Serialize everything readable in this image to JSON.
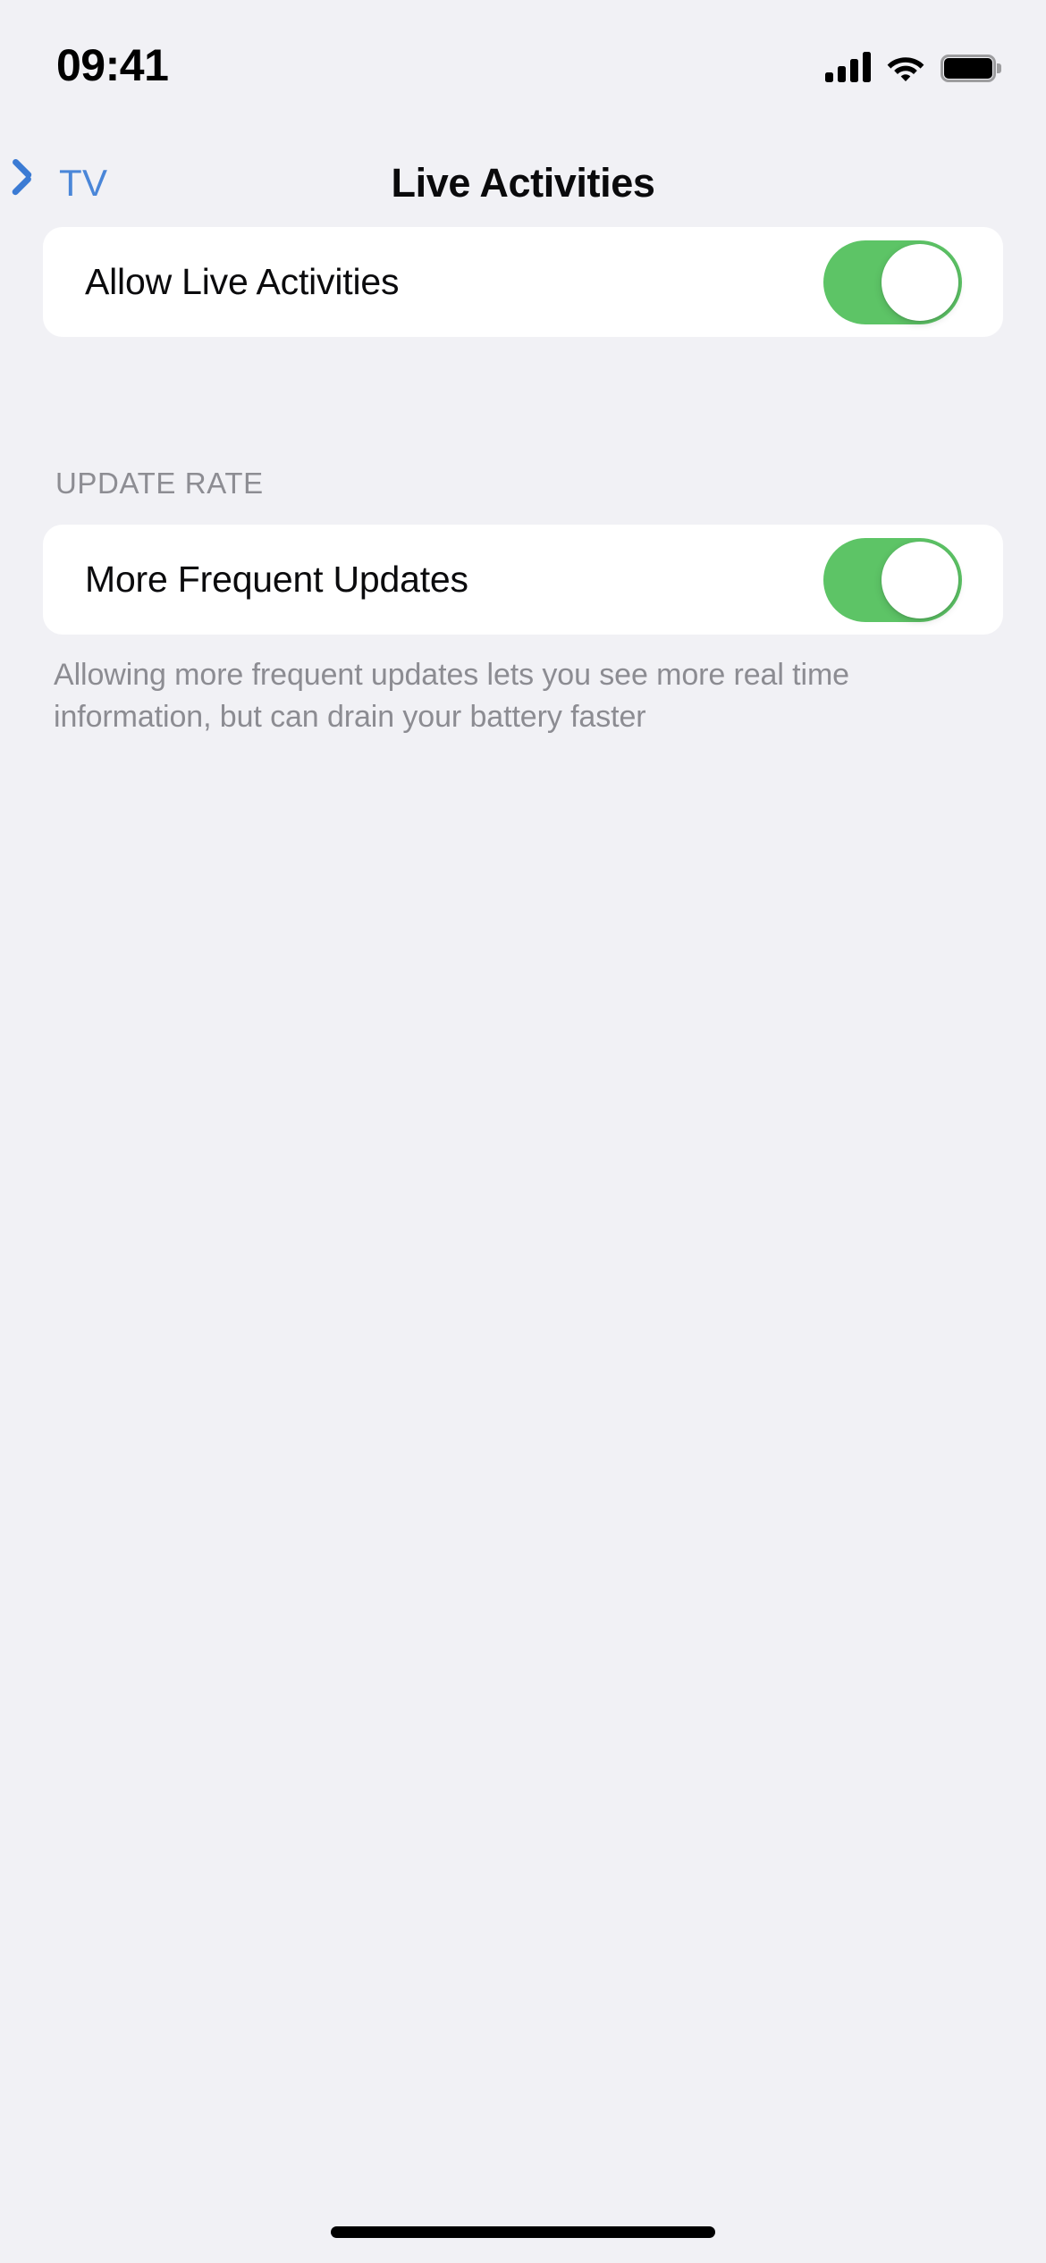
{
  "status_bar": {
    "time": "09:41",
    "signal_icon": "cellular-signal-icon",
    "signal_bars": 4,
    "wifi_icon": "wifi-icon",
    "battery_icon": "battery-full-icon",
    "battery_level_percent": 100
  },
  "nav": {
    "back_icon": "chevron-left-icon",
    "back_label": "TV",
    "title": "Live Activities"
  },
  "sections": [
    {
      "header": "",
      "rows": [
        {
          "label": "Allow Live Activities",
          "control": "toggle",
          "value": "on"
        }
      ],
      "footer": ""
    },
    {
      "header": "UPDATE RATE",
      "rows": [
        {
          "label": "More Frequent Updates",
          "control": "toggle",
          "value": "on"
        }
      ],
      "footer": "Allowing more frequent updates lets you see more real time information, but can drain your battery faster"
    }
  ],
  "home_indicator": "home-indicator",
  "colors": {
    "page_background": "#F1F1F5",
    "card_background": "#FFFFFF",
    "accent_blue": "#4A86D8",
    "toggle_on_green": "#5DC466",
    "primary_text": "#0B0B0D",
    "secondary_text": "#8C8C92"
  }
}
